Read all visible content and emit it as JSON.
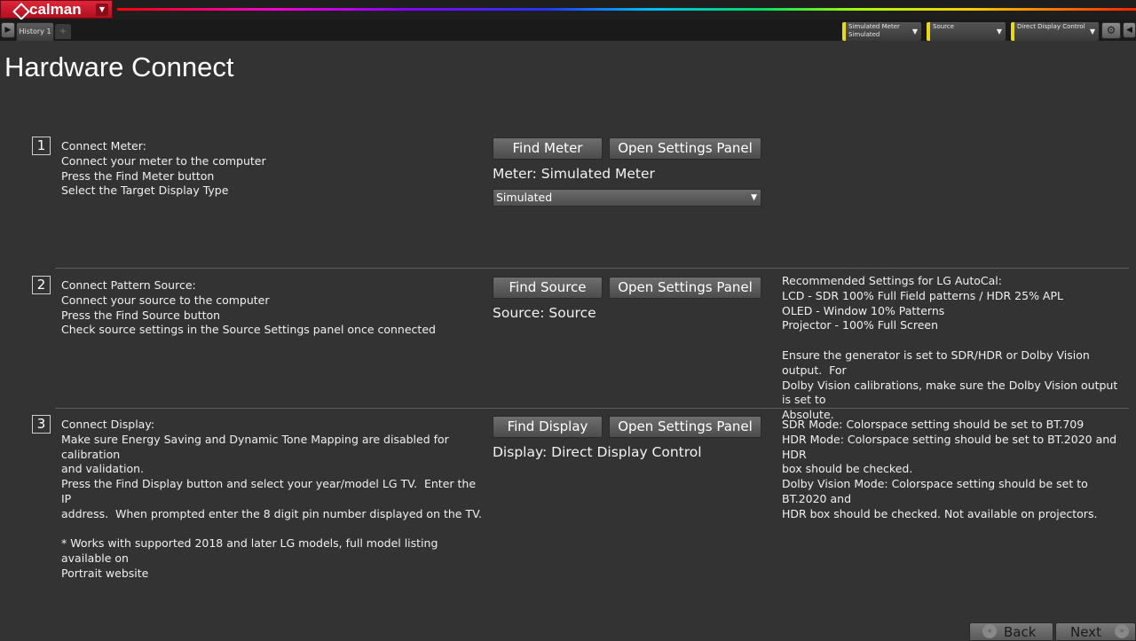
{
  "app": {
    "logo_text": "calman",
    "history_tab": "History 1",
    "add_tab": "+",
    "devices": [
      {
        "line1": "Simulated Meter",
        "line2": "Simulated"
      },
      {
        "line1": "Source",
        "line2": ""
      },
      {
        "line1": "Direct Display Control",
        "line2": ""
      }
    ],
    "colors": {
      "accent": "#e0263a",
      "device_marker": "#e8d81c",
      "background": "#333333"
    }
  },
  "page": {
    "title": "Hardware Connect"
  },
  "steps": [
    {
      "number": "1",
      "lines": [
        "Connect Meter:",
        "Connect your meter to the computer",
        "Press the Find Meter button",
        "Select the Target Display Type"
      ],
      "find_label": "Find Meter",
      "settings_label": "Open Settings Panel",
      "status": "Meter: Simulated Meter",
      "dropdown_value": "Simulated"
    },
    {
      "number": "2",
      "lines": [
        "Connect Pattern Source:",
        "Connect your source to the computer",
        "Press the Find Source button",
        "Check source settings in the Source Settings panel once connected"
      ],
      "find_label": "Find Source",
      "settings_label": "Open Settings Panel",
      "status": "Source: Source",
      "notes": [
        "Recommended Settings for LG AutoCal:",
        "LCD - SDR 100% Full Field patterns / HDR 25% APL",
        "OLED - Window 10% Patterns",
        "Projector - 100% Full Screen",
        "",
        "Ensure the generator is set to SDR/HDR or Dolby Vision output.  For",
        "Dolby Vision calibrations, make sure the Dolby Vision output is set to",
        "Absolute."
      ]
    },
    {
      "number": "3",
      "lines": [
        "Connect Display:",
        "Make sure Energy Saving and Dynamic Tone Mapping are disabled for calibration",
        "and validation.",
        "Press the Find Display button and select your year/model LG TV.  Enter the IP",
        "address.  When prompted enter the 8 digit pin number displayed on the TV.",
        "",
        "* Works with supported 2018 and later LG models, full model listing available on",
        "Portrait website"
      ],
      "find_label": "Find Display",
      "settings_label": "Open Settings Panel",
      "status": "Display: Direct Display Control",
      "notes": [
        "SDR Mode: Colorspace setting should be set to BT.709",
        "HDR Mode: Colorspace setting should be set to BT.2020 and HDR",
        "box should be checked.",
        "Dolby Vision Mode: Colorspace setting should be set to BT.2020 and",
        "HDR box should be checked. Not available on projectors."
      ]
    }
  ],
  "footer": {
    "back_label": "Back",
    "next_label": "Next"
  }
}
